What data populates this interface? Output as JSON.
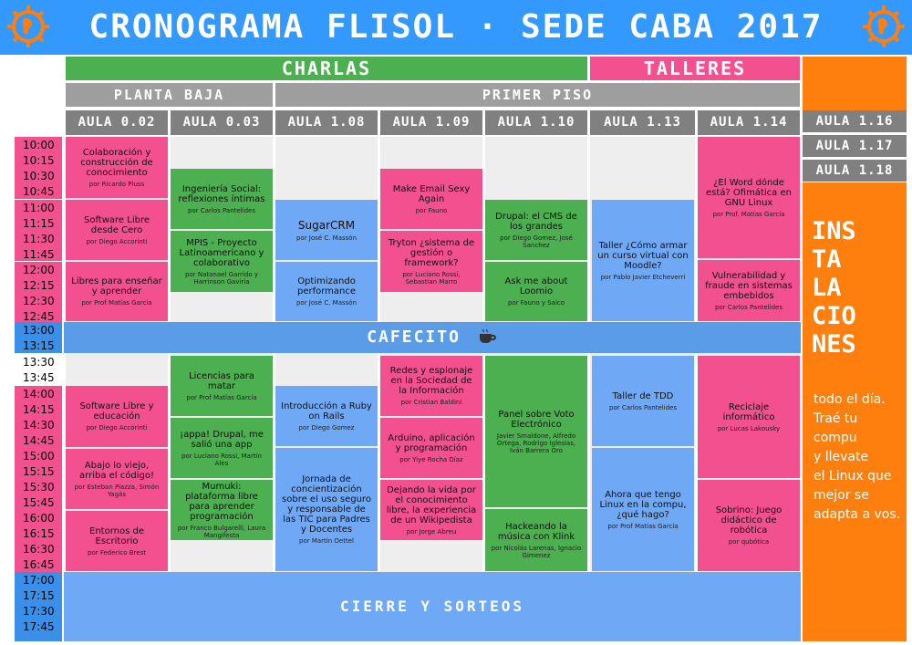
{
  "title": "CRONOGRAMA FLISOL · SEDE CABA 2017",
  "sections": {
    "charlas": "CHARLAS",
    "talleres": "TALLERES"
  },
  "floors": {
    "planta_baja": "PLANTA BAJA",
    "primer_piso": "PRIMER PISO"
  },
  "rooms": [
    "AULA 0.02",
    "AULA 0.03",
    "AULA 1.08",
    "AULA 1.09",
    "AULA 1.10",
    "AULA 1.13",
    "AULA 1.14"
  ],
  "rooms_right": [
    "AULA 1.16",
    "AULA 1.17",
    "AULA 1.18"
  ],
  "times": {
    "block1": [
      "10:00",
      "10:15",
      "10:30",
      "10:45"
    ],
    "block2": [
      "11:00",
      "11:15",
      "11:30",
      "11:45"
    ],
    "block3": [
      "12:00",
      "12:15",
      "12:30",
      "12:45"
    ],
    "block4": [
      "13:00",
      "13:15"
    ],
    "block5": [
      "13:30",
      "13:45"
    ],
    "block6": [
      "14:00",
      "14:15",
      "14:30",
      "14:45"
    ],
    "block7": [
      "15:00",
      "15:15",
      "15:30",
      "15:45"
    ],
    "block8": [
      "16:00",
      "16:15",
      "16:30",
      "16:45"
    ],
    "block9": [
      "17:00",
      "17:15",
      "17:30",
      "17:45"
    ]
  },
  "events": {
    "a02_1": {
      "title": "Colaboración y construcción de conocimiento",
      "speaker": "por Ricardo Pluss"
    },
    "a02_2": {
      "title": "Software Libre desde Cero",
      "speaker": "por Diego Accorinti"
    },
    "a02_3": {
      "title": "Libres para enseñar y aprender",
      "speaker": "por Prof Matías García"
    },
    "a02_4": {
      "title": "Software Libre y educación",
      "speaker": "por Diego Accorinti"
    },
    "a02_5": {
      "title": "Abajo lo viejo, arriba el código!",
      "speaker": "por Esteban Piazza, Simón Yagás"
    },
    "a02_6": {
      "title": "Entornos de Escritorio",
      "speaker": "por Federico Brest"
    },
    "a03_1": {
      "title": "Ingeniería Social: reflexiones íntimas",
      "speaker": "por Carlos Pantelides"
    },
    "a03_2": {
      "title": "MPIS - Proyecto Latinoamericano y colaborativo",
      "speaker": "por Natanael Garrido y Harrinson Gaviria"
    },
    "a03_3": {
      "title": "Licencias para matar",
      "speaker": "por Prof Matías García"
    },
    "a03_4": {
      "title": "¡appa! Drupal, me salió una app",
      "speaker": "por Luciano Rossi, Martín Ales"
    },
    "a03_5": {
      "title": "Mumuki: plataforma libre para aprender programación",
      "speaker": "por Franco Bulgarelli, Laura Mangifesta"
    },
    "a108_1": {
      "title": "SugarCRM",
      "speaker": "por José C. Massón"
    },
    "a108_2": {
      "title": "Optimizando performance",
      "speaker": "por José C. Massón"
    },
    "a108_3": {
      "title": "Introducción a Ruby on Rails",
      "speaker": "por Diego Gomez"
    },
    "a108_4": {
      "title": "Jornada de concientización sobre el uso seguro y responsable de las TIC para Padres y Docentes",
      "speaker": "por Martín Oettel"
    },
    "a109_1": {
      "title": "Make Email Sexy Again",
      "speaker": "por Fauno"
    },
    "a109_2": {
      "title": "Tryton ¿sistema de gestión o framework?",
      "speaker": "por Luciano Rossi, Sebastian Marro"
    },
    "a109_3": {
      "title": "Redes y espionaje en la Sociedad de la Información",
      "speaker": "por Cristian Baldini"
    },
    "a109_4": {
      "title": "Arduino, aplicación y programación",
      "speaker": "por Yiye Rocha Díaz"
    },
    "a109_5": {
      "title": "Dejando la vida por el conocimiento libre, la experiencia de un Wikipedista",
      "speaker": "por Jorge Abreu"
    },
    "a110_1": {
      "title": "Drupal: el CMS de los grandes",
      "speaker": "por Diego Gomez, José Sanchez"
    },
    "a110_2": {
      "title": "Ask me about Loomio",
      "speaker": "por Fauno y Saico"
    },
    "a110_3": {
      "title": "Panel sobre Voto Electrónico",
      "speaker": "Javier Smaldone, Alfredo Ortega, Rodrigo Iglesias, Iván Barrera Oro"
    },
    "a110_4": {
      "title": "Hackeando la música con Klink",
      "speaker": "por Nicolás Larenas, Ignacio Gimenez"
    },
    "a113_1": {
      "title": "Taller ¿Cómo armar un curso virtual con Moodle?",
      "speaker": "por Pablo Javier Etcheverri"
    },
    "a113_2": {
      "title": "Taller de TDD",
      "speaker": "por Carlos Pantelides"
    },
    "a113_3": {
      "title": "Ahora que tengo Linux en la compu, ¿qué hago?",
      "speaker": "por Prof Matías García"
    },
    "a114_1": {
      "title": "¿El Word dónde está? Ofimática en GNU Linux",
      "speaker": "por Prof. Matías García"
    },
    "a114_2": {
      "title": "Vulnerabilidad y fraude en sistemas embebidos",
      "speaker": "por Carlos Pantelides"
    },
    "a114_3": {
      "title": "Reciclaje informático",
      "speaker": "por Lucas Lakousky"
    },
    "a114_4": {
      "title": "Sobrino: Juego didáctico de robótica",
      "speaker": "por qubótica"
    }
  },
  "break_label": "CAFECITO",
  "closing_label": "CIERRE Y SORTEOS",
  "installs": {
    "heading_lines": [
      "INS",
      "TA",
      "LA",
      "CIO",
      "NES"
    ],
    "text_lines": [
      "todo el día.",
      "Traé tu",
      "compu",
      "y llevate",
      "el Linux que",
      "mejor se",
      "adapta a vos."
    ]
  },
  "colors": {
    "header": "#3399ff",
    "charlas": "#4caf50",
    "talleres": "#f2508f",
    "pink": "#f2508f",
    "green": "#4caf50",
    "blue": "#6fa8f5",
    "orange": "#ff7f0e",
    "gray": "#808080"
  },
  "icons": [
    "flisol-logo-icon",
    "coffee-cup-icon"
  ]
}
